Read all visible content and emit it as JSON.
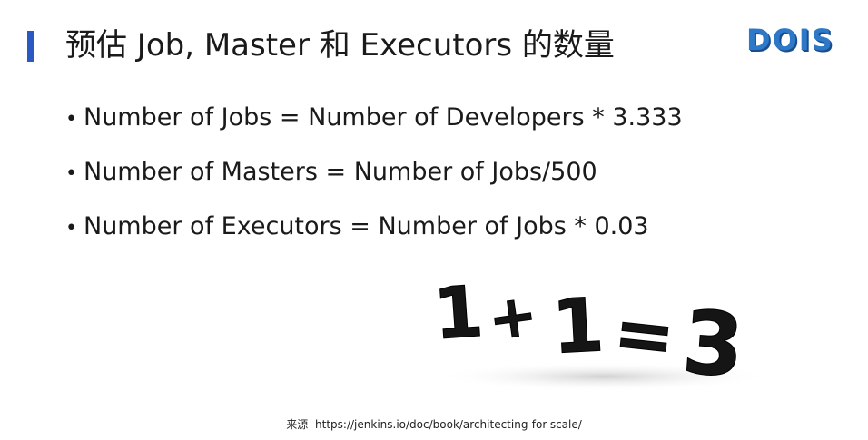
{
  "slide": {
    "title": "预估 Job, Master 和 Executors 的数量",
    "logo_text": "DOIS",
    "accent_color": "#2b59c3",
    "logo_color": "#2e78c8",
    "bullets": [
      {
        "marker": "•",
        "text": "Number of Jobs  = Number of Developers * 3.333"
      },
      {
        "marker": "•",
        "text": "Number of Masters = Number of Jobs/500"
      },
      {
        "marker": "•",
        "text": "Number of Executors = Number of Jobs * 0.03"
      }
    ],
    "image": {
      "glyphs": [
        "1",
        "+",
        "1",
        "=",
        "3"
      ]
    },
    "source": {
      "label": "来源",
      "url": "https://jenkins.io/doc/book/architecting-for-scale/"
    }
  }
}
